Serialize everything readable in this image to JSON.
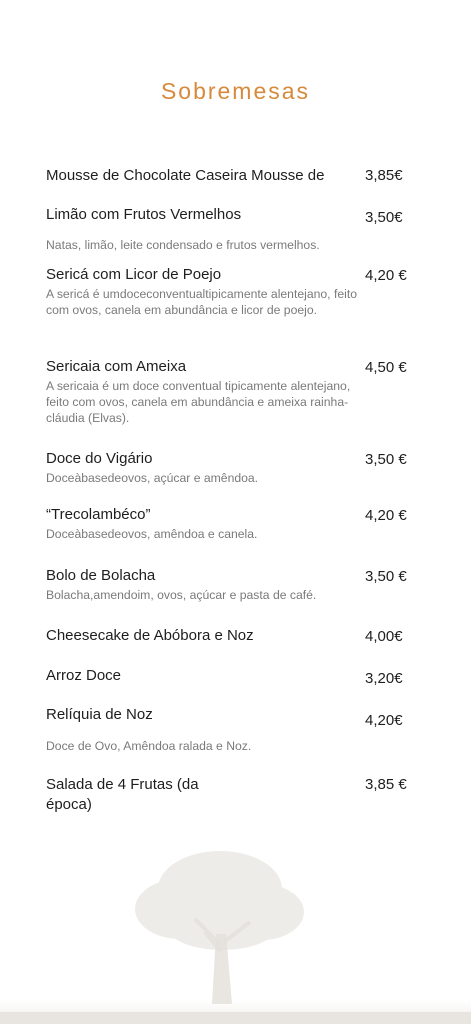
{
  "title": "Sobremesas",
  "colors": {
    "title": "#d68a3c",
    "text": "#1e1e1e",
    "desc": "#7a7a7a"
  },
  "items": [
    {
      "name": "Mousse de Chocolate Caseira Mousse de",
      "price": "3,85€",
      "desc": ""
    },
    {
      "name": "Limão com Frutos Vermelhos",
      "price": "3,50€",
      "desc": "Natas, limão, leite condensado e frutos vermelhos."
    },
    {
      "name": "Sericá com Licor de Poejo",
      "price": "4,20 €",
      "desc": "A sericá é umdoceconventualtipicamente alentejano, feito com ovos, canela em abundância e licor de poejo."
    },
    {
      "name": "Sericaia com Ameixa",
      "price": "4,50 €",
      "desc": "A sericaia é um doce conventual tipicamente alentejano, feito com ovos, canela em abundância e ameixa rainha-cláudia (Elvas)."
    },
    {
      "name": "Doce do Vigário",
      "price": "3,50 €",
      "desc": "Doceàbasedeovos, açúcar e amêndoa."
    },
    {
      "name": "“Trecolambéco”",
      "price": "4,20 €",
      "desc": "Doceàbasedeovos, amêndoa e canela."
    },
    {
      "name": "Bolo de Bolacha",
      "price": "3,50 €",
      "desc": "Bolacha,amendoim, ovos, açúcar e pasta de café."
    },
    {
      "name": "Cheesecake de Abóbora e Noz",
      "price": "4,00€",
      "desc": ""
    },
    {
      "name": "Arroz Doce",
      "price": "3,20€",
      "desc": ""
    },
    {
      "name": "Relíquia de Noz",
      "price": "4,20€",
      "desc": "Doce de Ovo, Amêndoa ralada e Noz."
    },
    {
      "name": "Salada de 4 Frutas (da época)",
      "price": "3,85 €",
      "desc": ""
    }
  ]
}
